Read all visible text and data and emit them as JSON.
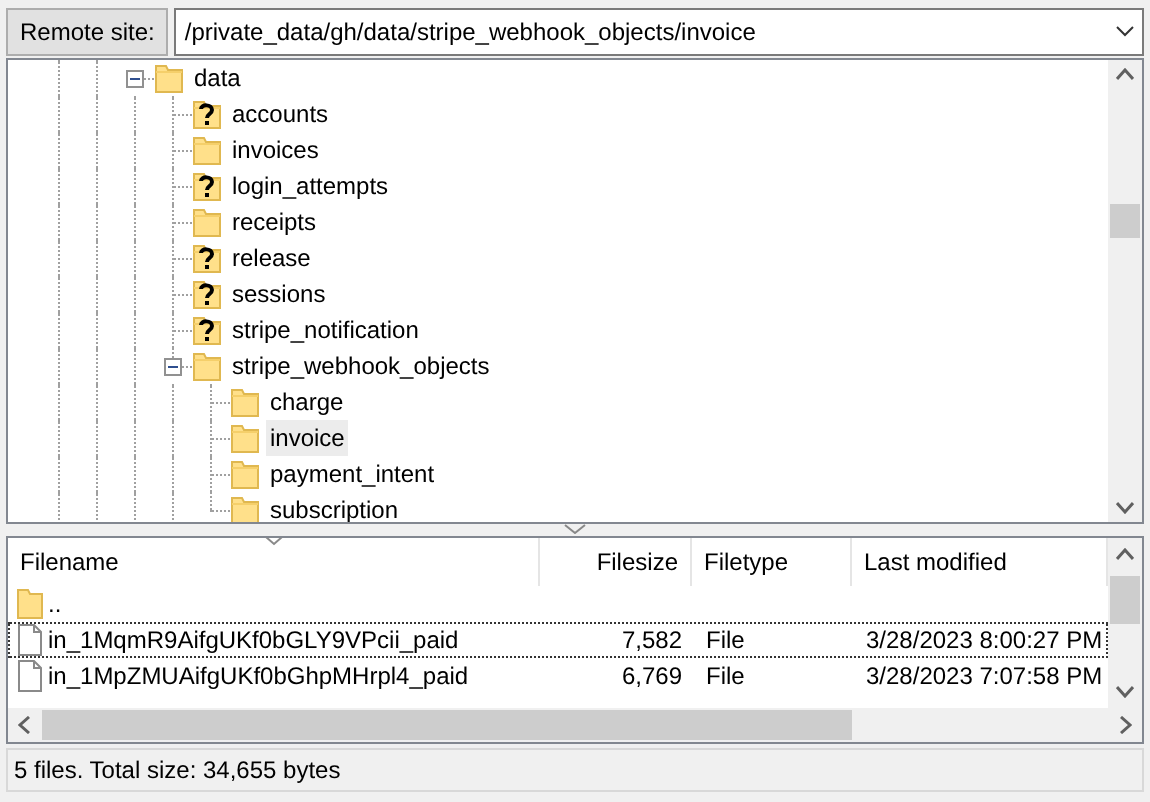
{
  "remote_site": {
    "label": "Remote site:",
    "path": "/private_data/gh/data/stripe_webhook_objects/invoice"
  },
  "tree": [
    {
      "name": "data",
      "kind": "folder",
      "selected": false,
      "expanded": true,
      "children": [
        {
          "name": "accounts",
          "kind": "unknown",
          "selected": false
        },
        {
          "name": "invoices",
          "kind": "folder",
          "selected": false
        },
        {
          "name": "login_attempts",
          "kind": "unknown",
          "selected": false
        },
        {
          "name": "receipts",
          "kind": "folder",
          "selected": false
        },
        {
          "name": "release",
          "kind": "unknown",
          "selected": false
        },
        {
          "name": "sessions",
          "kind": "unknown",
          "selected": false
        },
        {
          "name": "stripe_notification",
          "kind": "unknown",
          "selected": false
        },
        {
          "name": "stripe_webhook_objects",
          "kind": "folder",
          "selected": false,
          "expanded": true,
          "children": [
            {
              "name": "charge",
              "kind": "folder",
              "selected": false
            },
            {
              "name": "invoice",
              "kind": "folder",
              "selected": true
            },
            {
              "name": "payment_intent",
              "kind": "folder",
              "selected": false
            },
            {
              "name": "subscription",
              "kind": "folder",
              "selected": false
            }
          ]
        }
      ]
    }
  ],
  "file_list": {
    "columns": [
      {
        "label": "Filename",
        "sorted": true
      },
      {
        "label": "Filesize",
        "sorted": false
      },
      {
        "label": "Filetype",
        "sorted": false
      },
      {
        "label": "Last modified",
        "sorted": false
      }
    ],
    "rows": [
      {
        "kind": "parent",
        "filename": "..",
        "focused": false
      },
      {
        "kind": "file",
        "filename": "in_1MqmR9AifgUKf0bGLY9VPcii_paid",
        "filesize": "7,582",
        "filetype": "File",
        "last_modified": "3/28/2023 8:00:27 PM",
        "focused": true
      },
      {
        "kind": "file",
        "filename": "in_1MpZMUAifgUKf0bGhpMHrpl4_paid",
        "filesize": "6,769",
        "filetype": "File",
        "last_modified": "3/28/2023 7:07:58 PM",
        "focused": false
      }
    ]
  },
  "status_bar": "5 files. Total size: 34,655 bytes"
}
